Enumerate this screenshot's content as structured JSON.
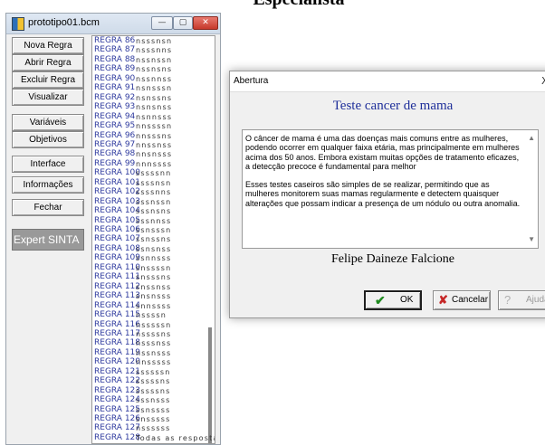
{
  "page": {
    "heading": "Especialista"
  },
  "main_window": {
    "title": "prototipo01.bcm",
    "controls": {
      "minimize": "—",
      "maximize": "▢",
      "close": "✕"
    }
  },
  "buttons": {
    "nova_regra": "Nova Regra",
    "abrir_regra": "Abrir Regra",
    "excluir_regra": "Excluir Regra",
    "visualizar": "Visualizar",
    "variaveis": "Variáveis",
    "objetivos": "Objetivos",
    "interface": "Interface",
    "informacoes": "Informações",
    "fechar": "Fechar",
    "expert": "Expert SINTA"
  },
  "rules": [
    {
      "name": "REGRA 86",
      "value": "nsssnsn"
    },
    {
      "name": "REGRA 87",
      "value": "nsssnns"
    },
    {
      "name": "REGRA 88",
      "value": "nssnssn"
    },
    {
      "name": "REGRA 89",
      "value": "nssnsns"
    },
    {
      "name": "REGRA 90",
      "value": "nssnnss"
    },
    {
      "name": "REGRA 91",
      "value": "nsnsssn"
    },
    {
      "name": "REGRA 92",
      "value": "nsnssns"
    },
    {
      "name": "REGRA 93",
      "value": "nsnsnss"
    },
    {
      "name": "REGRA 94",
      "value": "nsnnsss"
    },
    {
      "name": "REGRA 95",
      "value": "nnssssn"
    },
    {
      "name": "REGRA 96",
      "value": "nnsssns"
    },
    {
      "name": "REGRA 97",
      "value": "nnssnss"
    },
    {
      "name": "REGRA 98",
      "value": "nnsnsss"
    },
    {
      "name": "REGRA 99",
      "value": "nnnssss"
    },
    {
      "name": "REGRA 100",
      "value": "sssssnn"
    },
    {
      "name": "REGRA 101",
      "value": "ssssnsn"
    },
    {
      "name": "REGRA 102",
      "value": "ssssnns"
    },
    {
      "name": "REGRA 103",
      "value": "sssnssn"
    },
    {
      "name": "REGRA 104",
      "value": "sssnsns"
    },
    {
      "name": "REGRA 105",
      "value": "sssnnss"
    },
    {
      "name": "REGRA 106",
      "value": "ssnsssn"
    },
    {
      "name": "REGRA 107",
      "value": "ssnssns"
    },
    {
      "name": "REGRA 108",
      "value": "ssnsnss"
    },
    {
      "name": "REGRA 109",
      "value": "ssnnsss"
    },
    {
      "name": "REGRA 110",
      "value": "snssssn"
    },
    {
      "name": "REGRA 111",
      "value": "snsssns"
    },
    {
      "name": "REGRA 112",
      "value": "snssnss"
    },
    {
      "name": "REGRA 113",
      "value": "snsnsss"
    },
    {
      "name": "REGRA 114",
      "value": "snnssss"
    },
    {
      "name": "REGRA 115",
      "value": "nssssn"
    },
    {
      "name": "REGRA 116",
      "value": "nsssssn"
    },
    {
      "name": "REGRA 117",
      "value": "nssssns"
    },
    {
      "name": "REGRA 118",
      "value": "nsssnss"
    },
    {
      "name": "REGRA 119",
      "value": "nssnsss"
    },
    {
      "name": "REGRA 120",
      "value": "nnsssss"
    },
    {
      "name": "REGRA 121",
      "value": "ssssssn"
    },
    {
      "name": "REGRA 122",
      "value": "sssssns"
    },
    {
      "name": "REGRA 123",
      "value": "sssssns"
    },
    {
      "name": "REGRA 124",
      "value": "sssnsss"
    },
    {
      "name": "REGRA 125",
      "value": "ssnssss"
    },
    {
      "name": "REGRA 126",
      "value": "snsssss"
    },
    {
      "name": "REGRA 127",
      "value": "nssssss"
    },
    {
      "name": "REGRA 128",
      "value": "Todas as resposta"
    }
  ],
  "dialog": {
    "title": "Abertura",
    "close": "X",
    "heading": "Teste cancer de mama",
    "paragraph1": "O câncer de mama é uma das doenças mais comuns entre as mulheres, podendo ocorrer em qualquer faixa etária, mas principalmente em mulheres acima dos 50 anos. Embora existam muitas opções de tratamento eficazes, a detecção precoce é fundamental para melhor",
    "paragraph2": "Esses testes caseiros são simples de se realizar, permitindo que as mulheres monitorem suas mamas regularmente e detectem quaisquer alterações que possam indicar a presença de um nódulo ou outra anomalia.",
    "author": "Felipe Daineze Falcione",
    "ok": "OK",
    "cancel": "Cancelar",
    "help": "Ajuda",
    "icons": {
      "ok": "✔",
      "cancel": "✘",
      "help": "?"
    }
  }
}
